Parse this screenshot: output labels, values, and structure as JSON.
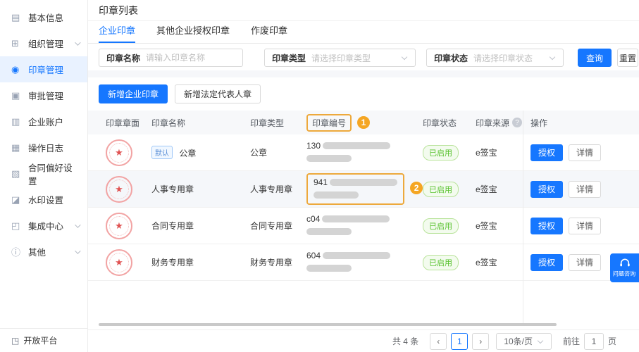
{
  "sidebar": {
    "items": [
      {
        "label": "基本信息",
        "glyph": "▤",
        "icon": "info-icon",
        "expandable": false,
        "active": false
      },
      {
        "label": "组织管理",
        "glyph": "⊞",
        "icon": "org-icon",
        "expandable": true,
        "active": false
      },
      {
        "label": "印章管理",
        "glyph": "◉",
        "icon": "seal-icon",
        "expandable": false,
        "active": true
      },
      {
        "label": "审批管理",
        "glyph": "▣",
        "icon": "approval-icon",
        "expandable": false,
        "active": false
      },
      {
        "label": "企业账户",
        "glyph": "▥",
        "icon": "account-icon",
        "expandable": false,
        "active": false
      },
      {
        "label": "操作日志",
        "glyph": "▦",
        "icon": "log-icon",
        "expandable": false,
        "active": false
      },
      {
        "label": "合同偏好设置",
        "glyph": "▧",
        "icon": "contract-pref-icon",
        "expandable": false,
        "active": false
      },
      {
        "label": "水印设置",
        "glyph": "◪",
        "icon": "watermark-icon",
        "expandable": false,
        "active": false
      },
      {
        "label": "集成中心",
        "glyph": "◰",
        "icon": "integration-icon",
        "expandable": true,
        "active": false
      },
      {
        "label": "其他",
        "glyph": "ⓘ",
        "icon": "other-icon",
        "expandable": true,
        "active": false
      }
    ],
    "footer": {
      "label": "开放平台",
      "glyph": "◳"
    }
  },
  "header": {
    "title": "印章列表"
  },
  "tabs": [
    {
      "label": "企业印章"
    },
    {
      "label": "其他企业授权印章"
    },
    {
      "label": "作废印章"
    }
  ],
  "filters": {
    "name": {
      "label": "印章名称",
      "placeholder": "请输入印章名称",
      "value": ""
    },
    "type": {
      "label": "印章类型",
      "placeholder": "请选择印章类型"
    },
    "status": {
      "label": "印章状态",
      "placeholder": "请选择印章状态"
    },
    "search_label": "查询",
    "reset_label": "重置"
  },
  "actions": {
    "add_enterprise_seal": "新增企业印章",
    "add_legal_rep_seal": "新增法定代表人章"
  },
  "table": {
    "columns": [
      "印章章面",
      "印章名称",
      "印章类型",
      "印章编号",
      "印章状态",
      "印章来源",
      "操作"
    ],
    "annotations": {
      "step1": "1",
      "step2": "2"
    },
    "action_labels": {
      "authorize": "授权",
      "details": "详情"
    },
    "rows": [
      {
        "default_badge": "默认",
        "name": "公章",
        "type": "公章",
        "number_prefix": "130",
        "status": "已启用",
        "source": "e签宝"
      },
      {
        "name": "人事专用章",
        "type": "人事专用章",
        "number_prefix": "941",
        "status": "已启用",
        "source": "e签宝"
      },
      {
        "name": "合同专用章",
        "type": "合同专用章",
        "number_prefix": "c04",
        "status": "已启用",
        "source": "e签宝"
      },
      {
        "name": "财务专用章",
        "type": "财务专用章",
        "number_prefix": "604",
        "status": "已启用",
        "source": "e签宝"
      }
    ]
  },
  "pagination": {
    "total": "共 4 条",
    "current_page": "1",
    "page_size": "10条/页",
    "goto_label": "前往",
    "goto_value": "1",
    "page_unit": "页"
  },
  "float_button": {
    "label": "问题咨询"
  },
  "icons": {
    "star": "★",
    "question": "?",
    "prev": "‹",
    "next": "›"
  },
  "colors": {
    "primary": "#1677ff",
    "annotation_orange": "#f5a623",
    "status_green": "#57c22d",
    "seal_red": "#e05252"
  }
}
